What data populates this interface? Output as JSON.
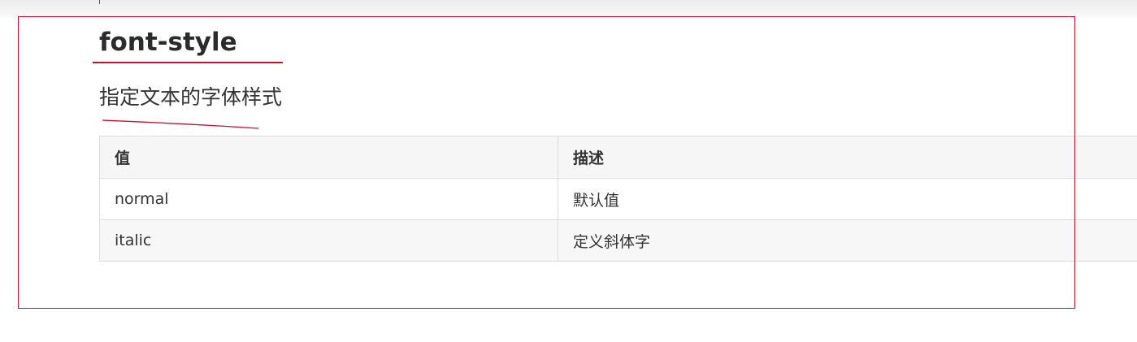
{
  "page": {
    "title": "font-style",
    "subtitle": "指定文本的字体样式"
  },
  "table": {
    "headers": [
      "值",
      "描述"
    ],
    "rows": [
      [
        "normal",
        "默认值"
      ],
      [
        "italic",
        "定义斜体字"
      ]
    ]
  },
  "colors": {
    "annotation": "#c8102e",
    "text": "#333333",
    "border": "#dddddd"
  }
}
